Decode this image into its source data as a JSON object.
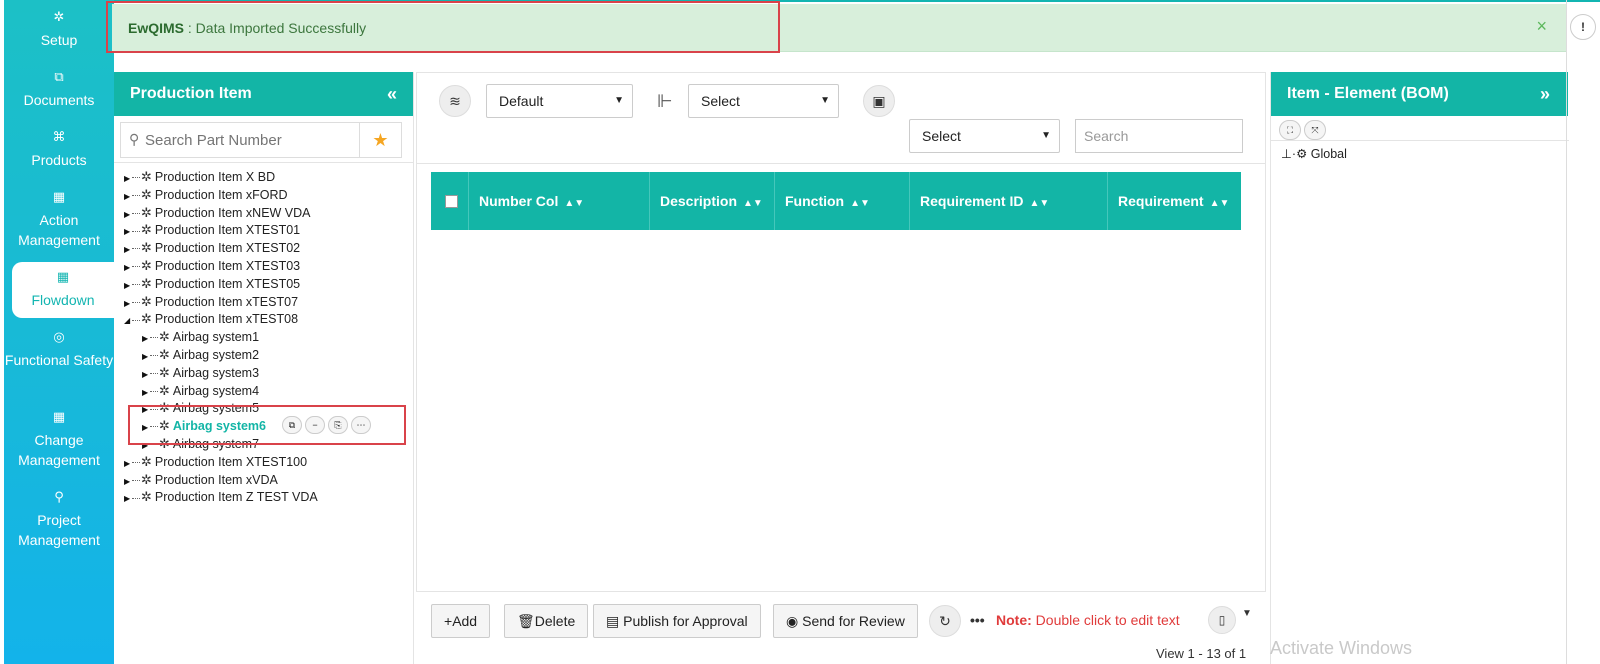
{
  "nav": {
    "items": [
      {
        "label": "Setup",
        "icon": "gears-icon"
      },
      {
        "label": "Documents",
        "icon": "copy-icon"
      },
      {
        "label": "Products",
        "icon": "cube-icon"
      },
      {
        "label": "Action Management",
        "icon": "building-icon"
      },
      {
        "label": "Flowdown",
        "icon": "building-icon",
        "active": true
      },
      {
        "label": "Functional Safety",
        "icon": "life-ring-icon"
      },
      {
        "label": "Change Management",
        "icon": "building-icon"
      },
      {
        "label": "Project Management",
        "icon": "sitemap-icon"
      }
    ]
  },
  "toast": {
    "app": "EwQIMS",
    "message": ": Data Imported Successfully",
    "close": "×",
    "right_button": "!"
  },
  "production_panel": {
    "title": "Production Item",
    "collapse": "«",
    "search_placeholder": "Search Part Number",
    "star": "★",
    "tree": [
      {
        "label": "Production Item X BD",
        "level": 0
      },
      {
        "label": "Production Item xFORD",
        "level": 0
      },
      {
        "label": "Production Item xNEW VDA",
        "level": 0
      },
      {
        "label": "Production Item XTEST01",
        "level": 0
      },
      {
        "label": "Production Item XTEST02",
        "level": 0
      },
      {
        "label": "Production Item XTEST03",
        "level": 0
      },
      {
        "label": "Production Item XTEST05",
        "level": 0
      },
      {
        "label": "Production Item xTEST07",
        "level": 0
      },
      {
        "label": "Production Item xTEST08",
        "level": 0,
        "expanded": true
      },
      {
        "label": "Airbag system1",
        "level": 1
      },
      {
        "label": "Airbag system2",
        "level": 1
      },
      {
        "label": "Airbag system3",
        "level": 1
      },
      {
        "label": "Airbag system4",
        "level": 1
      },
      {
        "label": "Airbag system5",
        "level": 1
      },
      {
        "label": "Airbag system6",
        "level": 1,
        "selected": true
      },
      {
        "label": "Airbag system7",
        "level": 1
      },
      {
        "label": "Production Item XTEST100",
        "level": 0
      },
      {
        "label": "Production Item xVDA",
        "level": 0
      },
      {
        "label": "Production Item Z TEST VDA",
        "level": 0
      }
    ],
    "row_actions": [
      "⧉",
      "−",
      "⎘",
      "⋯"
    ]
  },
  "center": {
    "select_default": "Default",
    "select_function": "Select",
    "select_secondary": "Select",
    "search_placeholder": "Search",
    "columns": [
      "Number Col",
      "Description",
      "Function",
      "Requirement ID",
      "Requirement"
    ]
  },
  "toolbar": {
    "add": "Add",
    "delete": "Delete",
    "publish": "Publish for Approval",
    "send": "Send for Review",
    "more": "•••",
    "note_label": "Note:",
    "note_text": "Double click to edit text",
    "view": "View 1 - 13 of 1"
  },
  "right_panel": {
    "title": "Item - Element (BOM)",
    "expand": "»",
    "root": "Global"
  },
  "watermark": "Activate Windows"
}
